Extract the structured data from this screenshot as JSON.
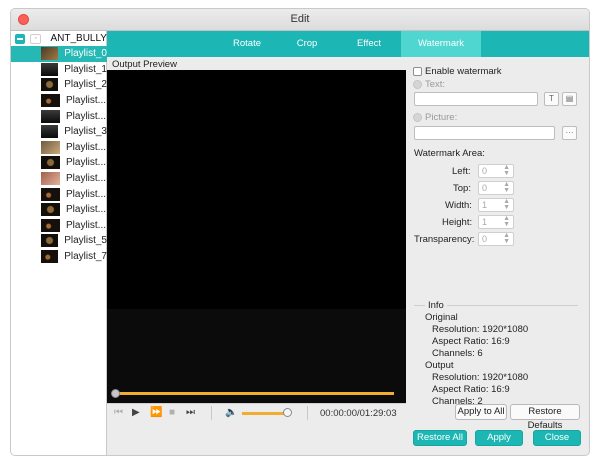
{
  "window": {
    "title": "Edit"
  },
  "sidebar": {
    "project": "ANT_BULLY",
    "items": [
      {
        "label": "Playlist_0",
        "thumb": "a",
        "selected": true
      },
      {
        "label": "Playlist_1",
        "thumb": "d",
        "selected": false
      },
      {
        "label": "Playlist_2",
        "thumb": "b",
        "selected": false
      },
      {
        "label": "Playlist...",
        "thumb": "c",
        "selected": false
      },
      {
        "label": "Playlist...",
        "thumb": "d",
        "selected": false
      },
      {
        "label": "Playlist_3",
        "thumb": "d",
        "selected": false
      },
      {
        "label": "Playlist...",
        "thumb": "e",
        "selected": false
      },
      {
        "label": "Playlist...",
        "thumb": "b",
        "selected": false
      },
      {
        "label": "Playlist...",
        "thumb": "f",
        "selected": false
      },
      {
        "label": "Playlist...",
        "thumb": "c",
        "selected": false
      },
      {
        "label": "Playlist...",
        "thumb": "b",
        "selected": false
      },
      {
        "label": "Playlist...",
        "thumb": "c",
        "selected": false
      },
      {
        "label": "Playlist_5",
        "thumb": "b",
        "selected": false
      },
      {
        "label": "Playlist_7",
        "thumb": "c",
        "selected": false
      }
    ]
  },
  "tabs": [
    {
      "label": "Rotate",
      "active": false
    },
    {
      "label": "Crop",
      "active": false
    },
    {
      "label": "Effect",
      "active": false
    },
    {
      "label": "Watermark",
      "active": true
    }
  ],
  "preview": {
    "label": "Output Preview",
    "timecode": "00:00:00/01:29:03"
  },
  "watermark": {
    "enable_label": "Enable watermark",
    "text_label": "Text:",
    "picture_label": "Picture:",
    "picture_browse": "···",
    "area_label": "Watermark Area:",
    "left_label": "Left:",
    "top_label": "Top:",
    "width_label": "Width:",
    "height_label": "Height:",
    "transparency_label": "Transparency:",
    "left_value": "0",
    "top_value": "0",
    "width_value": "1",
    "height_value": "1",
    "transparency_value": "0"
  },
  "info": {
    "title": "Info",
    "original_title": "Original",
    "original_resolution": "Resolution: 1920*1080",
    "original_aspect": "Aspect Ratio: 16:9",
    "original_channels": "Channels: 6",
    "output_title": "Output",
    "output_resolution": "Resolution: 1920*1080",
    "output_aspect": "Aspect Ratio: 16:9",
    "output_channels": "Channels: 2"
  },
  "buttons": {
    "apply_to_all": "Apply to All",
    "restore_defaults": "Restore Defaults",
    "restore_all": "Restore All",
    "apply": "Apply",
    "close": "Close"
  },
  "colors": {
    "accent": "#1cb7b4",
    "accent_light": "#4fd6d1",
    "progress": "#f0ad30"
  }
}
